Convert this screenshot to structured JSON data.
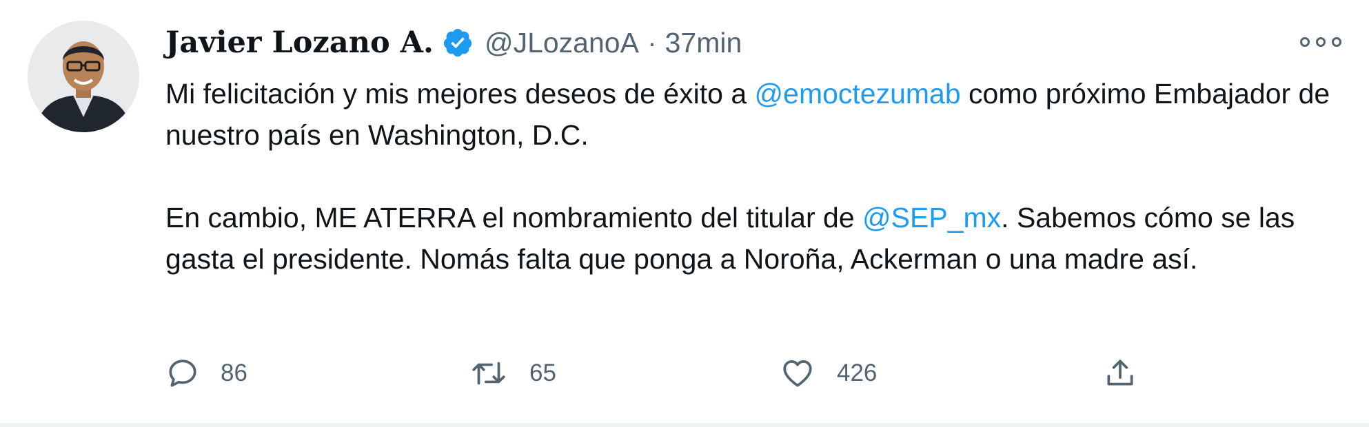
{
  "tweet": {
    "author": {
      "display_name": "Javier Lozano A.",
      "handle": "@JLozanoA",
      "verified": true,
      "avatar_icon": "person-avatar"
    },
    "separator": "·",
    "time": "37min",
    "more_icon": "more-horizontal-icon",
    "text": {
      "p1_prefix": "Mi felicitación y mis mejores deseos de éxito a ",
      "p1_mention": "@emoctezumab",
      "p1_suffix": " como próximo Embajador de nuestro país en Washington, D.C.",
      "p2_prefix": "En cambio, ME ATERRA el nombramiento del titular de ",
      "p2_mention": "@SEP_mx",
      "p2_suffix": ". Sabemos cómo se las gasta el presidente. Nomás falta que ponga a Noroña, Ackerman o una madre así."
    },
    "actions": {
      "reply_count": "86",
      "retweet_count": "65",
      "like_count": "426"
    },
    "colors": {
      "accent": "#1d9bf0",
      "secondary_text": "#536471",
      "primary_text": "#0f1419"
    }
  }
}
